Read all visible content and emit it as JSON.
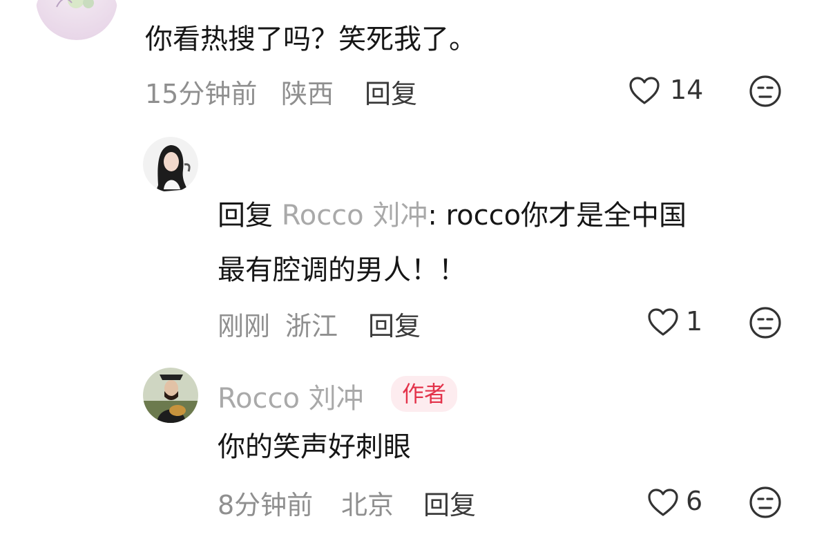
{
  "comments": [
    {
      "text": "你看热搜了吗？笑死我了。",
      "time": "15分钟前",
      "location": "陕西",
      "reply_label": "回复",
      "likes": "14"
    },
    {
      "reply_prefix": "回复",
      "reply_to": "Rocco 刘冲",
      "text_line1": ": rocco你才是全中国",
      "text_line2": "最有腔调的男人！！",
      "time": "刚刚",
      "location": "浙江",
      "reply_label": "回复",
      "likes": "1"
    },
    {
      "username": "Rocco 刘冲",
      "badge": "作者",
      "text": "你的笑声好刺眼",
      "time": "8分钟前",
      "location": "北京",
      "reply_label": "回复",
      "likes": "6"
    }
  ],
  "icons": [
    "heart-icon",
    "dislike-face-icon"
  ],
  "colors": {
    "author_badge_bg": "#fdecef",
    "author_badge_text": "#e3324a",
    "meta_gray": "#8f8f8f"
  }
}
